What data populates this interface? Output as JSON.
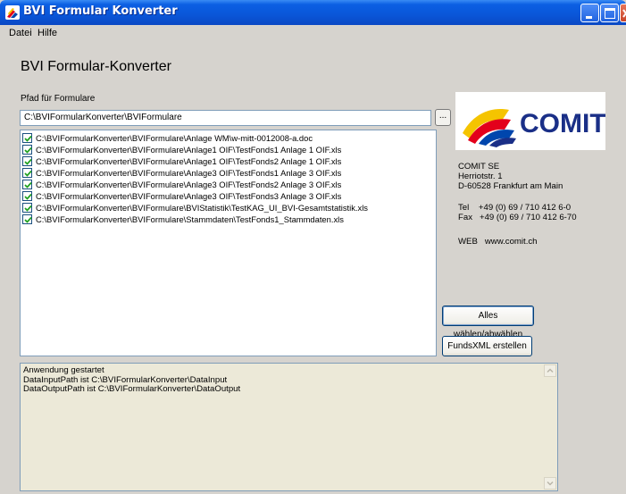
{
  "window": {
    "title": "BVI Formular Konverter",
    "icon": "app-logo-icon"
  },
  "menu": [
    "Datei",
    "Hilfe"
  ],
  "heading": "BVI Formular-Konverter",
  "path": {
    "label": "Pfad für Formulare",
    "value": "C:\\BVIFormularKonverter\\BVIFormulare",
    "browse_label": "..."
  },
  "files": [
    {
      "checked": true,
      "path": "C:\\BVIFormularKonverter\\BVIFormulare\\Anlage WM\\w-mitt-0012008-a.doc"
    },
    {
      "checked": true,
      "path": "C:\\BVIFormularKonverter\\BVIFormulare\\Anlage1 OIF\\TestFonds1 Anlage 1 OIF.xls"
    },
    {
      "checked": true,
      "path": "C:\\BVIFormularKonverter\\BVIFormulare\\Anlage1 OIF\\TestFonds2 Anlage 1 OIF.xls"
    },
    {
      "checked": true,
      "path": "C:\\BVIFormularKonverter\\BVIFormulare\\Anlage3 OIF\\TestFonds1 Anlage 3 OIF.xls"
    },
    {
      "checked": true,
      "path": "C:\\BVIFormularKonverter\\BVIFormulare\\Anlage3 OIF\\TestFonds2 Anlage 3 OIF.xls"
    },
    {
      "checked": true,
      "path": "C:\\BVIFormularKonverter\\BVIFormulare\\Anlage3 OIF\\TestFonds3 Anlage 3 OIF.xls"
    },
    {
      "checked": true,
      "path": "C:\\BVIFormularKonverter\\BVIFormulare\\BVIStatistik\\TestKAG_UI_BVI-Gesamtstatistik.xls"
    },
    {
      "checked": true,
      "path": "C:\\BVIFormularKonverter\\BVIFormulare\\Stammdaten\\TestFonds1_Stammdaten.xls"
    }
  ],
  "logo": {
    "text": "COMIT",
    "colors": [
      "#f5c400",
      "#e3001b",
      "#0046ad",
      "#1a2f87"
    ]
  },
  "company": {
    "name": "COMIT SE",
    "street": "Herriotstr. 1",
    "city": "D-60528 Frankfurt am Main",
    "tel": "Tel    +49 (0) 69 / 710 412 6-0",
    "fax": "Fax   +49 (0) 69 / 710 412 6-70",
    "web": "WEB   www.comit.ch"
  },
  "buttons": {
    "select_all": "Alles wählen/abwählen",
    "create": "FundsXML erstellen"
  },
  "log": [
    "Anwendung gestartet",
    "DataInputPath ist C:\\BVIFormularKonverter\\DataInput",
    "DataOutputPath ist C:\\BVIFormularKonverter\\DataOutput"
  ]
}
